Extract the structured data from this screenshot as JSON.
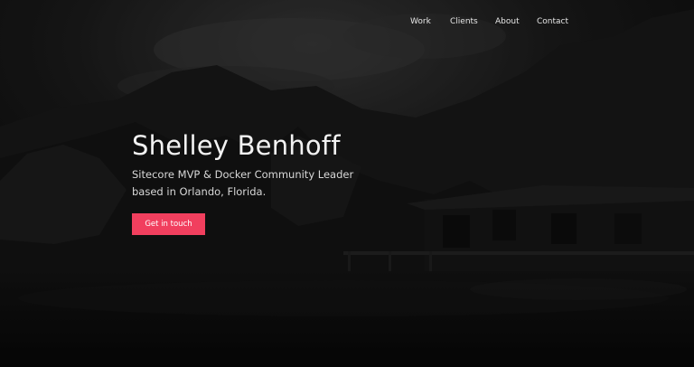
{
  "nav": {
    "items": [
      {
        "label": "Work"
      },
      {
        "label": "Clients"
      },
      {
        "label": "About"
      },
      {
        "label": "Contact"
      }
    ]
  },
  "hero": {
    "title": "Shelley Benhoff",
    "subtitle": "Sitecore MVP & Docker Community Leader based in Orlando, Florida.",
    "cta_label": "Get in touch"
  },
  "colors": {
    "accent": "#f13f5e",
    "background": "#0b0b0b"
  }
}
